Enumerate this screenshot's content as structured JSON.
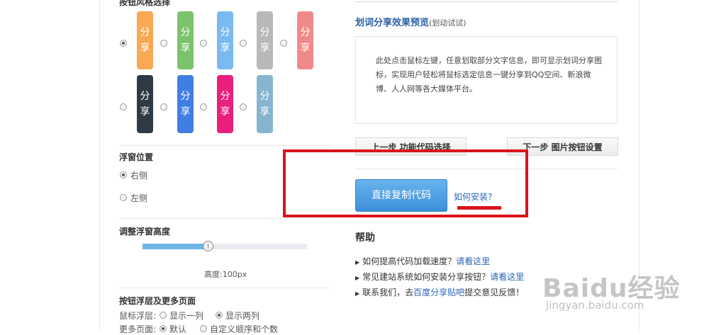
{
  "left": {
    "button_style_title": "按钮风格选择",
    "share_chars": [
      "分",
      "享"
    ],
    "style_colors": [
      "#f8a953",
      "#7cc26b",
      "#7bbaf0",
      "#b9b9b9",
      "#f08a8a",
      "#2e3a45",
      "#3f7ee3",
      "#ea1f7d",
      "#87b5d0"
    ],
    "float_position_title": "浮窗位置",
    "pos_right": "右侧",
    "pos_left": "左侧",
    "height_title": "调整浮窗高度",
    "height_value_label": "高度:100px",
    "slider_fill_fraction": 0.5,
    "more_title": "按钮浮层及更多页面",
    "mouse_layer_label": "鼠标浮层:",
    "show_one": "显示一列",
    "show_two": "显示两列",
    "more_pages_label": "更多页面:",
    "default_opt": "默认",
    "custom_opt": "自定义顺序和个数"
  },
  "right": {
    "preview_title": "划词分享效果预览",
    "preview_subtitle": "(划动试试)",
    "preview_text": "此处点击鼠标左键，任意划取部分文字信息，即可显示划词分享图标，实现用户轻松将鼠标选定信息一键分享到QQ空间、新浪微博、人人网等各大媒体平台。",
    "prev_step": "上一步 功能代码选择",
    "next_step": "下一步 图片按钮设置",
    "copy_code": "直接复制代码",
    "how_install": "如何安装?",
    "help_title": "帮助",
    "help_items": [
      {
        "text": "如何提高代码加载速度？",
        "link": "请看这里",
        "after": ""
      },
      {
        "text": "常见建站系统如何安装分享按钮？",
        "link": "请看这里",
        "after": ""
      },
      {
        "text": "联系我们，去",
        "link": "百度分享贴吧",
        "after": "提交意见反馈！"
      }
    ]
  },
  "watermark": {
    "brand": "Baidu经验",
    "url": "jingyan.baidu.com"
  },
  "colors": {
    "annotation_red": "#d9141b",
    "link_blue": "#2b65b5",
    "title_blue": "#2b62a8",
    "slider_blue": "#6fb6e6"
  }
}
